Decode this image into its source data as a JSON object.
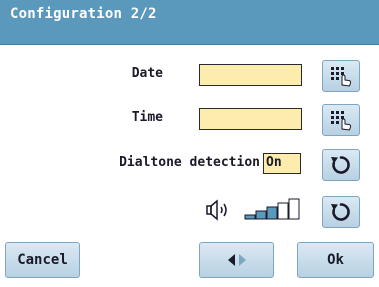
{
  "window": {
    "title": "Configuration 2/2"
  },
  "form": {
    "date_label": "Date",
    "date_value": "",
    "time_label": "Time",
    "time_value": "",
    "dialtone_label": "Dialtone detection",
    "dialtone_value": "On",
    "volume_level": 0.6
  },
  "icons": {
    "keypad": "keypad-touch-icon",
    "toggle": "rotate-cycle-icon",
    "speaker": "speaker-icon",
    "volume": "volume-bars-icon",
    "navigate": "prev-next-arrows-icon"
  },
  "footer": {
    "cancel_label": "Cancel",
    "ok_label": "Ok"
  },
  "colors": {
    "title_bar": "#5a98bc",
    "field_bg": "#fcecae",
    "button_bg": "#c8dceb"
  }
}
